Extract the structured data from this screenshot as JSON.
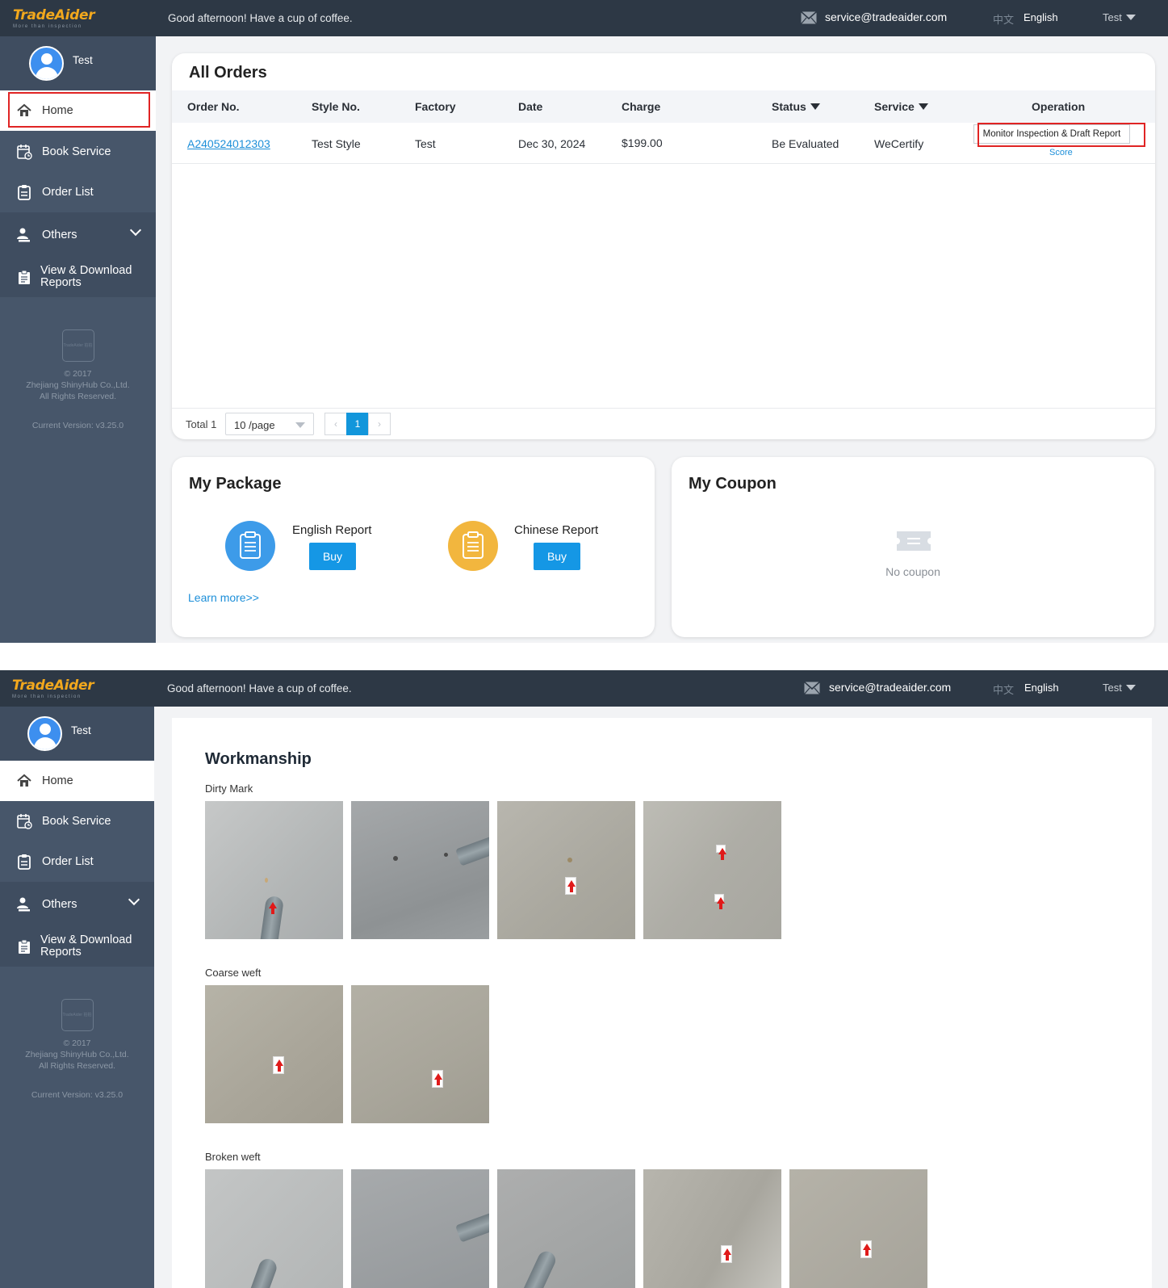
{
  "topbar": {
    "logo_main": "TradeAider",
    "logo_sub": "More than inspection",
    "greeting": "Good afternoon! Have a cup of coffee.",
    "email": "service@tradeaider.com",
    "lang_zh": "中文",
    "lang_en": "English",
    "user": "Test"
  },
  "sidebar": {
    "username": "Test",
    "items": [
      {
        "label": "Home",
        "icon": "home-icon"
      },
      {
        "label": "Book Service",
        "icon": "calendar-icon"
      },
      {
        "label": "Order List",
        "icon": "clipboard-icon"
      },
      {
        "label": "Others",
        "icon": "users-icon"
      },
      {
        "label": "View & Download Reports",
        "icon": "report-icon"
      }
    ],
    "footer_logo": "TradeAider 拍拍",
    "copyright": "© 2017",
    "company": "Zhejiang ShinyHub Co.,Ltd.",
    "rights": "All Rights Reserved.",
    "version": "Current Version: v3.25.0"
  },
  "orders": {
    "title": "All Orders",
    "columns": [
      "Order No.",
      "Style No.",
      "Factory",
      "Date",
      "Charge",
      "Status",
      "Service",
      "Operation"
    ],
    "rows": [
      {
        "order_no": "A240524012303",
        "style_no": "Test Style",
        "factory": "Test",
        "date": "Dec 30, 2024",
        "charge": "$199.00",
        "status": "Be Evaluated",
        "service": "WeCertify",
        "operation": "Monitor Inspection & Draft Report",
        "score": "Score"
      }
    ],
    "total": "Total 1",
    "page_size": "10 /page",
    "current_page": "1"
  },
  "package": {
    "title": "My Package",
    "english": {
      "label": "English Report",
      "button": "Buy",
      "color": "#3d9be9"
    },
    "chinese": {
      "label": "Chinese Report",
      "button": "Buy",
      "color": "#f2b63e"
    },
    "learn_more": "Learn more>>"
  },
  "coupon": {
    "title": "My Coupon",
    "empty": "No coupon"
  },
  "workmanship": {
    "title": "Workmanship",
    "sections": [
      {
        "label": "Dirty Mark",
        "count": 4
      },
      {
        "label": "Coarse weft",
        "count": 2
      },
      {
        "label": "Broken weft",
        "count": 5
      }
    ]
  },
  "colors": {
    "topbar": "#2d3845",
    "sidebar": "#47566a",
    "accent": "#1597e5",
    "highlight": "#e02424"
  }
}
